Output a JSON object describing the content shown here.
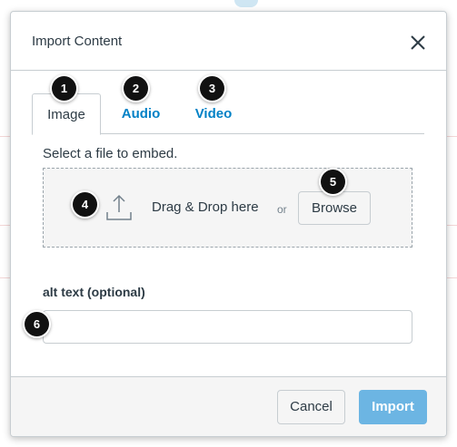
{
  "modal": {
    "title": "Import Content",
    "close_icon": "close-icon"
  },
  "tabs": [
    {
      "label": "Image",
      "active": true
    },
    {
      "label": "Audio",
      "active": false
    },
    {
      "label": "Video",
      "active": false
    }
  ],
  "upload": {
    "instruction": "Select a file to embed.",
    "icon": "upload-icon",
    "drag_text": "Drag & Drop here",
    "or_text": "or",
    "browse_label": "Browse"
  },
  "alt_text": {
    "label": "alt text (optional)",
    "value": "",
    "placeholder": ""
  },
  "footer": {
    "cancel_label": "Cancel",
    "import_label": "Import"
  },
  "callouts": [
    "1",
    "2",
    "3",
    "4",
    "5",
    "6"
  ],
  "colors": {
    "link": "#0081c6",
    "primary_button": "#6cb5e3",
    "callout": "#111111"
  }
}
